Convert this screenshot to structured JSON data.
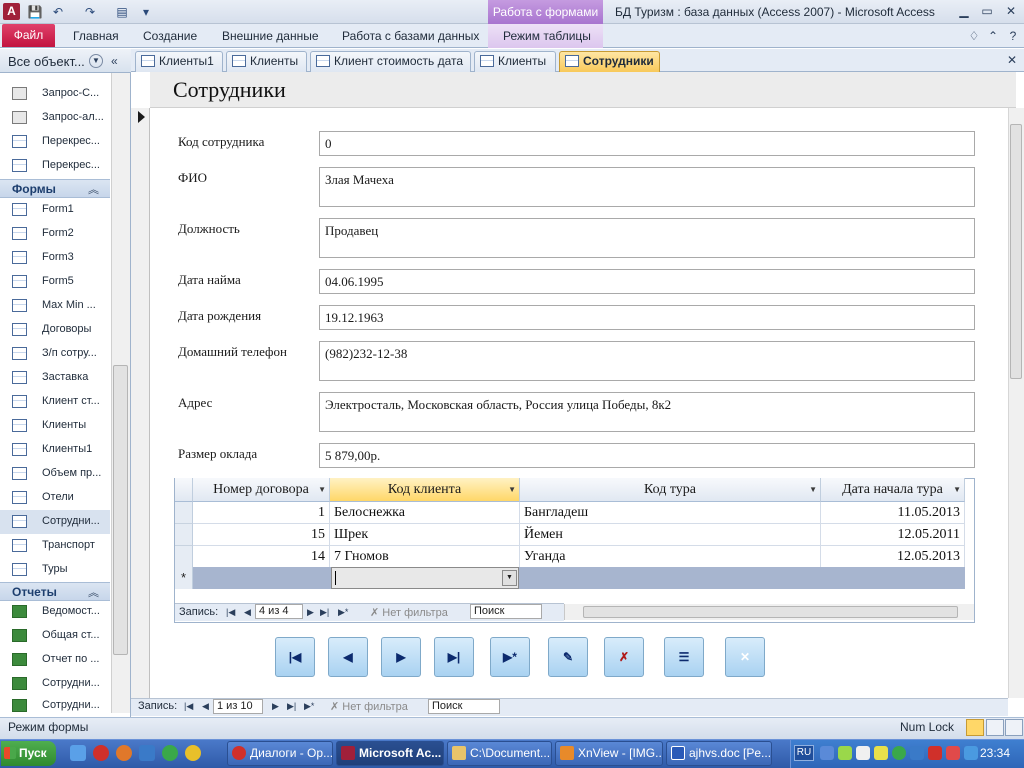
{
  "window": {
    "title": "БД Туризм : база данных (Access 2007)  -  Microsoft Access",
    "context_tab_header": "Работа с формами",
    "app_icon_letter": "A"
  },
  "ribbon": {
    "file_tab": "Файл",
    "tabs": [
      "Главная",
      "Создание",
      "Внешние данные",
      "Работа с базами данных",
      "Режим таблицы"
    ]
  },
  "nav": {
    "header": "Все объект...",
    "queries": [
      "Запрос-С...",
      "Запрос-ал...",
      "Перекрес...",
      "Перекрес..."
    ],
    "forms_group": "Формы",
    "forms": [
      "Form1",
      "Form2",
      "Form3",
      "Form5",
      "Max Min ...",
      "Договоры",
      "З/п сотру...",
      "Заставка",
      "Клиент ст...",
      "Клиенты",
      "Клиенты1",
      "Объем пр...",
      "Отели",
      "Сотрудни...",
      "Транспорт",
      "Туры"
    ],
    "reports_group": "Отчеты",
    "reports": [
      "Ведомост...",
      "Общая ст...",
      "Отчет по ...",
      "Сотрудни...",
      "Сотрудни..."
    ]
  },
  "doc_tabs": [
    "Клиенты1",
    "Клиенты",
    "Клиент стоимость дата",
    "Клиенты",
    "Сотрудники"
  ],
  "form": {
    "title": "Сотрудники",
    "fields": [
      {
        "label": "Код сотрудника",
        "value": "0"
      },
      {
        "label": "ФИО",
        "value": "Злая Мачеха"
      },
      {
        "label": "Должность",
        "value": "Продавец"
      },
      {
        "label": "Дата найма",
        "value": "04.06.1995"
      },
      {
        "label": "Дата рождения",
        "value": "19.12.1963"
      },
      {
        "label": "Домашний телефон",
        "value": "(982)232-12-38"
      },
      {
        "label": "Адрес",
        "value": "Электросталь, Московская область, Россия улица Победы, 8к2"
      },
      {
        "label": "Размер оклада",
        "value": "5 879,00р."
      }
    ]
  },
  "subform": {
    "columns": [
      "Номер договора",
      "Код клиента",
      "Код тура",
      "Дата начала тура"
    ],
    "rows": [
      [
        "1",
        "Белоснежка",
        "Бангладеш",
        "11.05.2013"
      ],
      [
        "15",
        "Шрек",
        "Йемен",
        "12.05.2011"
      ],
      [
        "14",
        "7 Гномов",
        "Уганда",
        "12.05.2013"
      ]
    ],
    "new_row_marker": "*",
    "nav": {
      "record_label": "Запись:",
      "record_pos": "4 из 4",
      "filter": "Нет фильтра",
      "search": "Поиск"
    }
  },
  "form_nav": {
    "record_label": "Запись:",
    "record_pos": "1 из 10",
    "filter": "Нет фильтра",
    "search": "Поиск"
  },
  "buttons": [
    {
      "name": "first-record-button",
      "glyph": "|◀"
    },
    {
      "name": "prev-record-button",
      "glyph": "◀"
    },
    {
      "name": "next-record-button",
      "glyph": "▶"
    },
    {
      "name": "last-record-button",
      "glyph": "▶|"
    },
    {
      "name": "new-record-button",
      "glyph": "▶*"
    },
    {
      "name": "save-record-button",
      "glyph": "✎"
    },
    {
      "name": "delete-record-button",
      "glyph": "✗"
    },
    {
      "name": "open-form-button",
      "glyph": "☰"
    },
    {
      "name": "close-form-button",
      "glyph": "✕"
    }
  ],
  "status": {
    "mode": "Режим формы",
    "numlock": "Num Lock"
  },
  "taskbar": {
    "start": "Пуск",
    "tasks": [
      "Диалоги - Ор...",
      "Microsoft Ac...",
      "C:\\Document...",
      "XnView - [IMG...",
      "ajhvs.doc [Pe..."
    ],
    "lang": "RU",
    "clock": "23:34"
  },
  "colors": {
    "accent": "#c2143f",
    "context": "#a874cf",
    "active_tab": "#f8c95a",
    "taskbar": "#2f5aa8"
  }
}
